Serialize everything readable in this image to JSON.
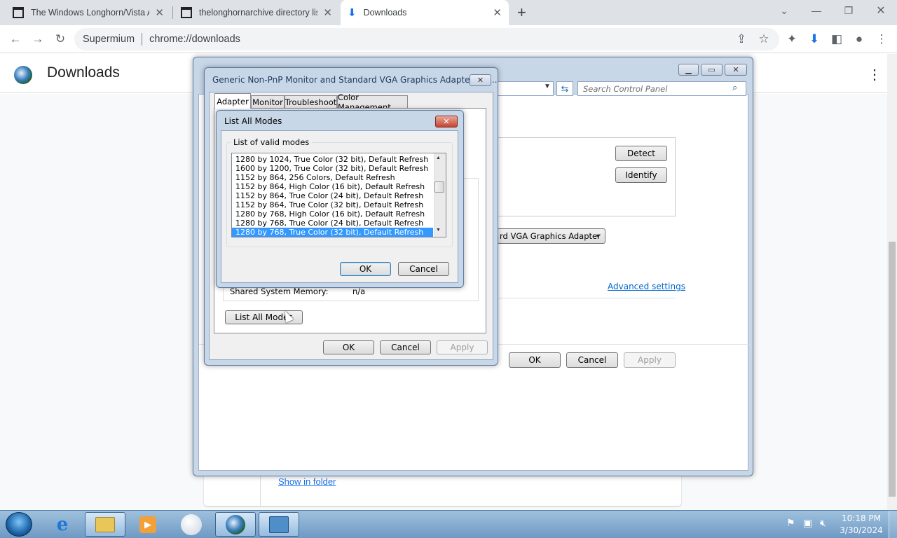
{
  "tabs": [
    {
      "title": "The Windows Longhorn/Vista Ar",
      "icon": "archive-icon"
    },
    {
      "title": "thelonghornarchive directory lis",
      "icon": "archive-icon"
    },
    {
      "title": "Downloads",
      "icon": "download-icon"
    }
  ],
  "omnibox": {
    "site": "Supermium",
    "url": "chrome://downloads"
  },
  "downloads": {
    "title": "Downloads",
    "show_in_folder": "Show in folder"
  },
  "control_panel": {
    "search_placeholder": "Search Control Panel",
    "detect": "Detect",
    "identify": "Identify",
    "adapter_dropdown": "rd VGA Graphics Adapter",
    "advanced_settings": "Advanced settings",
    "ok": "OK",
    "cancel": "Cancel",
    "apply": "Apply"
  },
  "properties": {
    "title": "Generic Non-PnP Monitor and Standard VGA Graphics Adapter Pro...",
    "tabs": [
      "Adapter",
      "Monitor",
      "Troubleshoot",
      "Color Management"
    ],
    "shared_memory_label": "Shared System Memory:",
    "shared_memory_value": "n/a",
    "list_all_modes": "List All Modes",
    "ok": "OK",
    "cancel": "Cancel",
    "apply": "Apply"
  },
  "list_modes": {
    "title": "List All Modes",
    "group_label": "List of valid modes",
    "modes": [
      "1280 by 1024, True Color (32 bit), Default Refresh",
      "1600 by 1200, True Color (32 bit), Default Refresh",
      "1152 by 864, 256 Colors, Default Refresh",
      "1152 by 864, High Color (16 bit), Default Refresh",
      "1152 by 864, True Color (24 bit), Default Refresh",
      "1152 by 864, True Color (32 bit), Default Refresh",
      "1280 by 768, High Color (16 bit), Default Refresh",
      "1280 by 768, True Color (24 bit), Default Refresh",
      "1280 by 768, True Color (32 bit), Default Refresh"
    ],
    "selected_index": 8,
    "ok": "OK",
    "cancel": "Cancel"
  },
  "taskbar": {
    "time": "10:18 PM",
    "date": "3/30/2024"
  },
  "colors": {
    "selection": "#3399ff",
    "link": "#1a73e8",
    "chrome_accent": "#1a73e8"
  }
}
